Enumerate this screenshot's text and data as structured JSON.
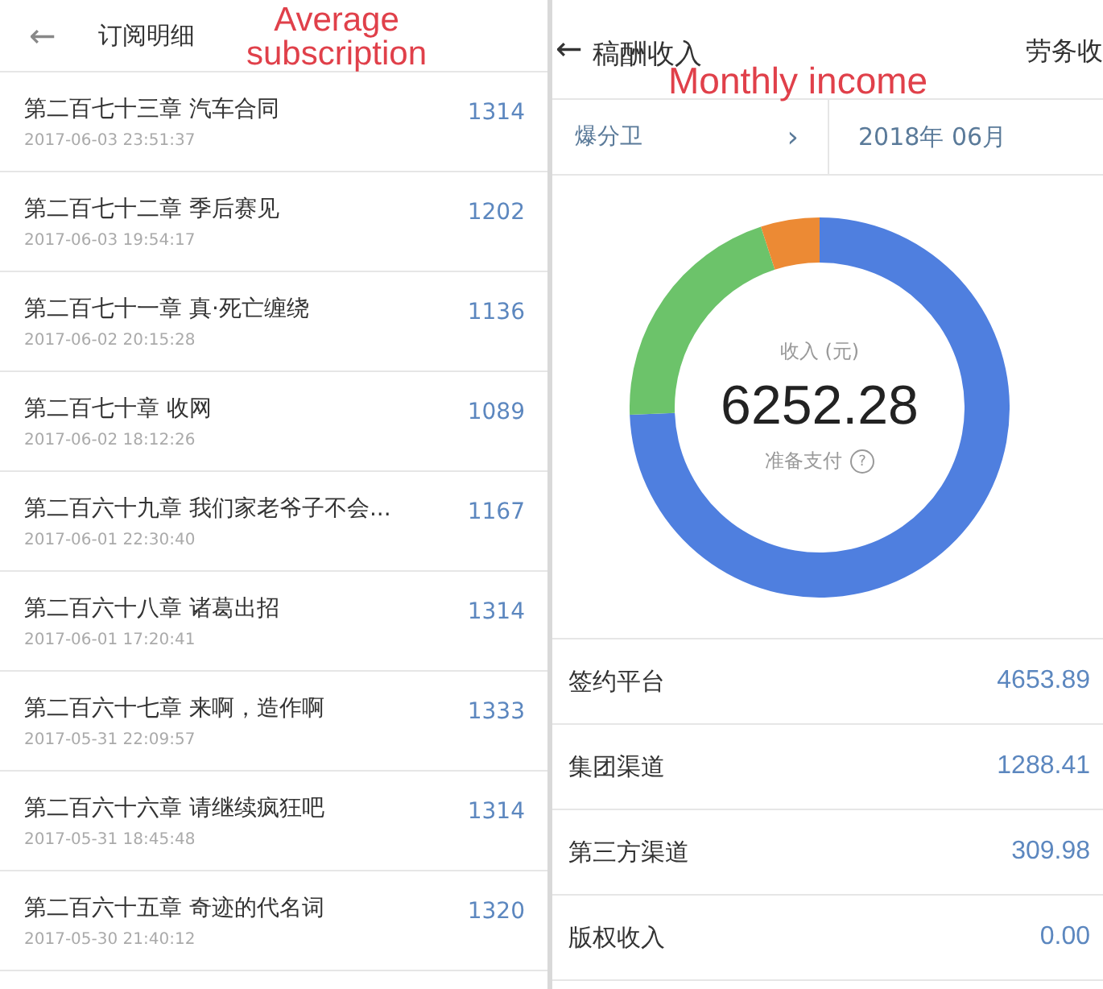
{
  "left_panel": {
    "back": "←",
    "title": "订阅明细",
    "annotation": "Average subscription",
    "rows": [
      {
        "chapter": "第二百七十三章 汽车合同",
        "time": "2017-06-03 23:51:37",
        "count": "1314"
      },
      {
        "chapter": "第二百七十二章 季后赛见",
        "time": "2017-06-03 19:54:17",
        "count": "1202"
      },
      {
        "chapter": "第二百七十一章 真·死亡缠绕",
        "time": "2017-06-02 20:15:28",
        "count": "1136"
      },
      {
        "chapter": "第二百七十章 收网",
        "time": "2017-06-02 18:12:26",
        "count": "1089"
      },
      {
        "chapter": "第二百六十九章 我们家老爷子不会...",
        "time": "2017-06-01 22:30:40",
        "count": "1167"
      },
      {
        "chapter": "第二百六十八章 诸葛出招",
        "time": "2017-06-01 17:20:41",
        "count": "1314"
      },
      {
        "chapter": "第二百六十七章 来啊，造作啊",
        "time": "2017-05-31 22:09:57",
        "count": "1333"
      },
      {
        "chapter": "第二百六十六章 请继续疯狂吧",
        "time": "2017-05-31 18:45:48",
        "count": "1314"
      },
      {
        "chapter": "第二百六十五章 奇迹的代名词",
        "time": "2017-05-30 21:40:12",
        "count": "1320"
      }
    ]
  },
  "right_panel": {
    "back": "←",
    "title": "稿酬收入",
    "tab": "劳务收",
    "annotation": "Monthly income",
    "book_filter": "爆分卫",
    "chevron": "›",
    "month": "2018年 06月",
    "summary": {
      "label": "收入 (元)",
      "total": "6252.28",
      "status": "准备支付",
      "help": "?",
      "chart_data": {
        "type": "donut",
        "values": [
          74.4,
          20.6,
          5.0
        ],
        "colors": [
          "#4f7fdf",
          "#6cc36a",
          "#ec8a34"
        ]
      }
    },
    "rows": [
      {
        "label": "签约平台",
        "amount": "4653.89"
      },
      {
        "label": "集团渠道",
        "amount": "1288.41"
      },
      {
        "label": "第三方渠道",
        "amount": "309.98"
      },
      {
        "label": "版权收入",
        "amount": "0.00"
      }
    ]
  }
}
